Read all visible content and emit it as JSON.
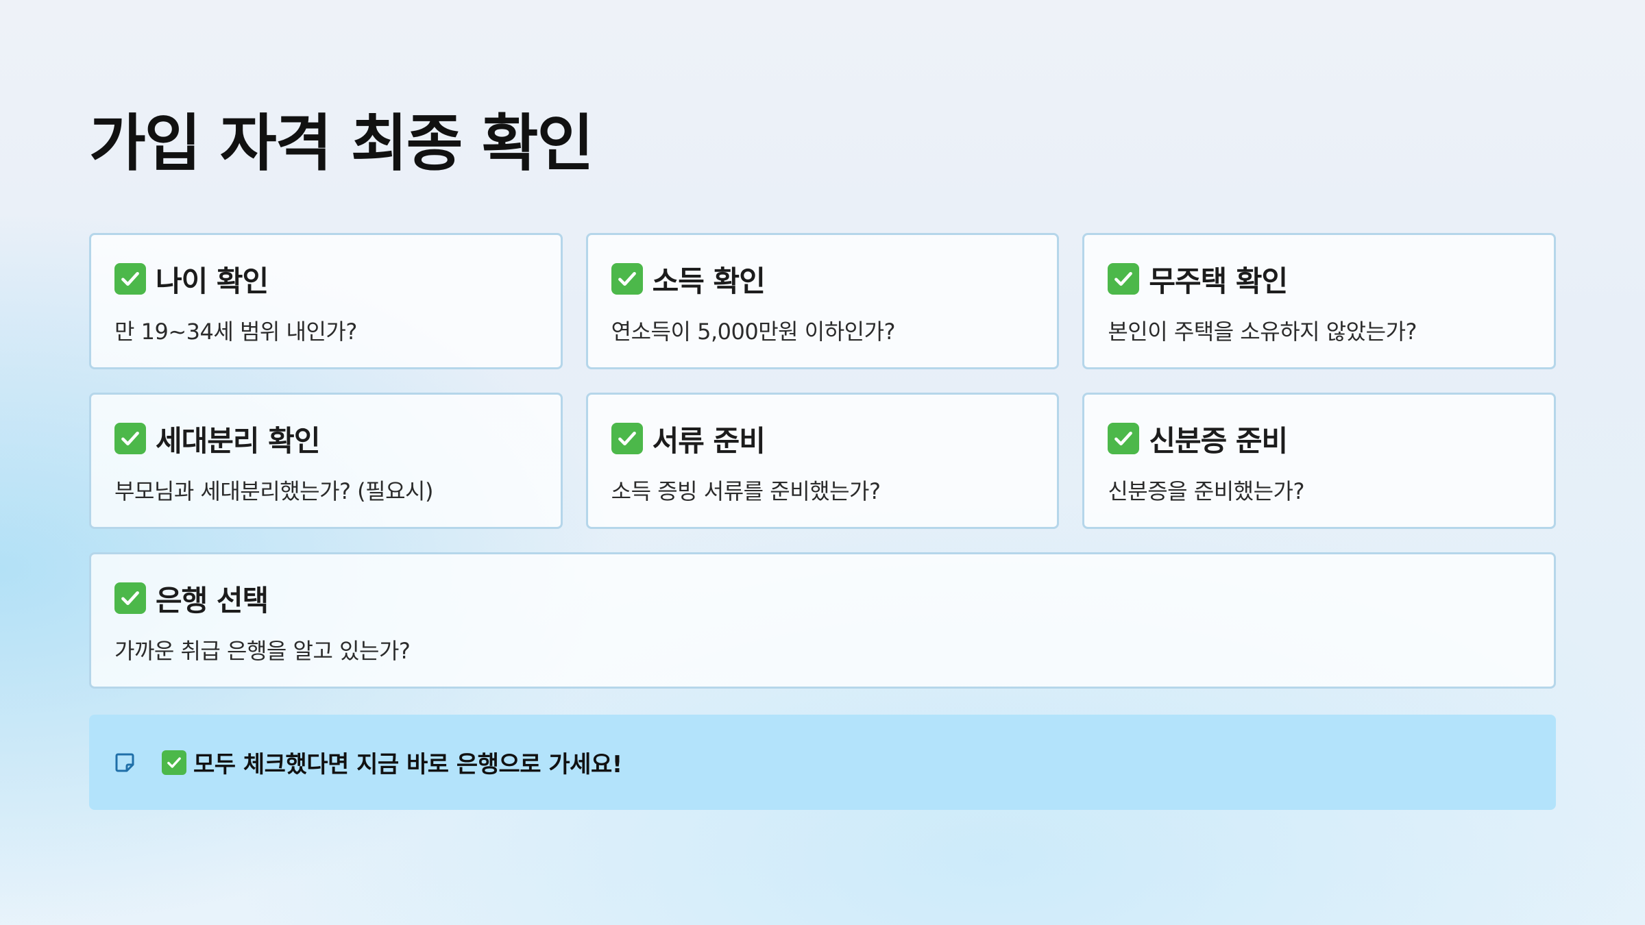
{
  "page": {
    "title": "가입 자격 최종 확인"
  },
  "checklist": [
    {
      "icon": "check-mark-button-icon",
      "title": "나이 확인",
      "description": "만 19~34세 범위 내인가?"
    },
    {
      "icon": "check-mark-button-icon",
      "title": "소득 확인",
      "description": "연소득이 5,000만원 이하인가?"
    },
    {
      "icon": "check-mark-button-icon",
      "title": "무주택 확인",
      "description": "본인이 주택을 소유하지 않았는가?"
    },
    {
      "icon": "check-mark-button-icon",
      "title": "세대분리 확인",
      "description": "부모님과 세대분리했는가? (필요시)"
    },
    {
      "icon": "check-mark-button-icon",
      "title": "서류 준비",
      "description": "소득 증빙 서류를 준비했는가?"
    },
    {
      "icon": "check-mark-button-icon",
      "title": "신분증 준비",
      "description": "신분증을 준비했는가?"
    },
    {
      "icon": "check-mark-button-icon",
      "title": "은행 선택",
      "description": "가까운 취급 은행을 알고 있는가?"
    }
  ],
  "banner": {
    "icon": "note-icon",
    "check_icon": "check-mark-button-icon",
    "text": "모두 체크했다면 지금 바로 은행으로 가세요!"
  },
  "colors": {
    "accent_check": "#4cb84a",
    "card_border": "#b5d6ea",
    "banner_background": "#b3e3fb",
    "note_icon": "#1f6fa8"
  }
}
